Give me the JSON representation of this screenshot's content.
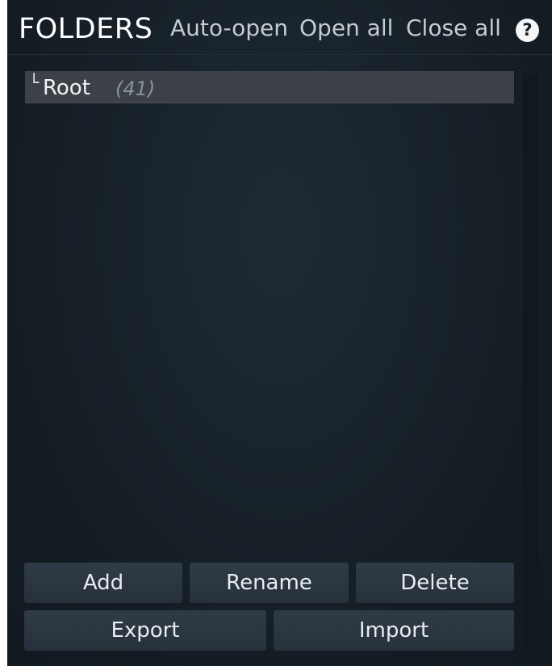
{
  "header": {
    "title": "FOLDERS",
    "auto_open": "Auto-open",
    "open_all": "Open all",
    "close_all": "Close all",
    "help": "?"
  },
  "tree": {
    "items": [
      {
        "branch": "└",
        "label": "Root",
        "count": "(41)"
      }
    ]
  },
  "buttons": {
    "add": "Add",
    "rename": "Rename",
    "delete": "Delete",
    "export": "Export",
    "import": "Import"
  },
  "colors": {
    "background": "#151d24",
    "selected_row": "#3b4146",
    "button": "#2a3540",
    "text": "#ffffff",
    "muted_text": "#8a939a"
  }
}
